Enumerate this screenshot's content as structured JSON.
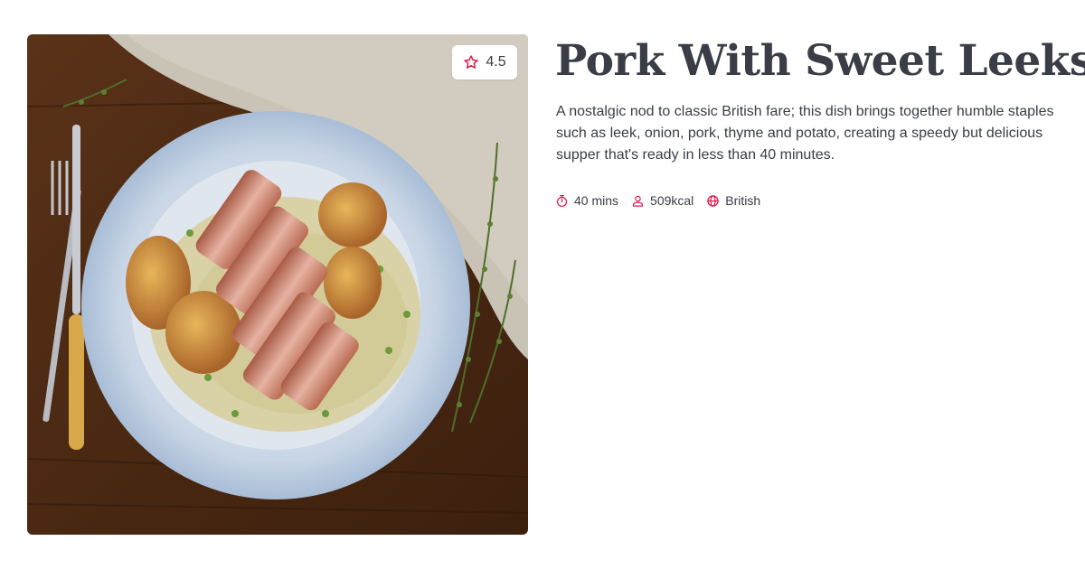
{
  "recipe": {
    "title": "Pork With Sweet Leeks",
    "description": "A nostalgic nod to classic British fare; this dish brings together humble staples such as leek, onion, pork, thyme and potato, creating a speedy but delicious supper that's ready in less than 40 minutes.",
    "rating": "4.5",
    "meta": {
      "time": "40 mins",
      "calories": "509kcal",
      "cuisine": "British"
    }
  },
  "icons": {
    "rating": "star-outline-icon",
    "time": "stopwatch-icon",
    "calories": "person-icon",
    "cuisine": "globe-icon"
  },
  "colors": {
    "accent": "#e0194a",
    "text": "#3a3d46",
    "background": "#ffffff"
  }
}
